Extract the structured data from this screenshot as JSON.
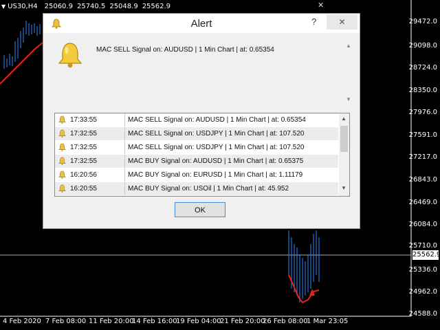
{
  "chart": {
    "symbol": "US30,H4",
    "quotes": [
      "25060.9",
      "25740.5",
      "25048.9",
      "25562.9"
    ],
    "y_ticks": [
      "29472.0",
      "29098.0",
      "28724.0",
      "28350.0",
      "27976.0",
      "27591.0",
      "27217.0",
      "26843.0",
      "26469.0",
      "26084.0",
      "25710.0",
      "25336.0",
      "24962.0",
      "24588.0"
    ],
    "x_ticks": [
      "4 Feb 2020",
      "7 Feb 08:00",
      "11 Feb 20:00",
      "14 Feb 16:00",
      "19 Feb 04:00",
      "21 Feb 20:00",
      "26 Feb 08:00",
      "1 Mar 23:05"
    ],
    "current_price": "25562.9",
    "close_glyph": "✕",
    "colors": {
      "background": "#000000",
      "ma_line": "#e8231f",
      "candles": "#2a8cff",
      "price_line": "#aaaaaa"
    }
  },
  "dialog": {
    "title": "Alert",
    "help": "?",
    "close": "✕",
    "message": "MAC SELL Signal on: AUDUSD | 1 Min Chart |  at: 0.65354",
    "rows": [
      {
        "time": "17:33:55",
        "message": "MAC SELL Signal on: AUDUSD | 1 Min Chart |  at: 0.65354"
      },
      {
        "time": "17:32:55",
        "message": "MAC SELL Signal on: USDJPY | 1 Min Chart |  at: 107.520"
      },
      {
        "time": "17:32:55",
        "message": "MAC SELL Signal on: USDJPY | 1 Min Chart |  at: 107.520"
      },
      {
        "time": "17:32:55",
        "message": "MAC BUY  Signal on: AUDUSD | 1 Min Chart |  at: 0.65375"
      },
      {
        "time": "16:20:56",
        "message": "MAC BUY  Signal on: EURUSD | 1 Min Chart |  at: 1.11179"
      },
      {
        "time": "16:20:55",
        "message": "MAC BUY  Signal on: USOil | 1 Min Chart |  at: 45.952"
      }
    ],
    "ok": "OK",
    "icon": "bell-icon",
    "scroll_up": "▲",
    "scroll_down": "▼"
  }
}
